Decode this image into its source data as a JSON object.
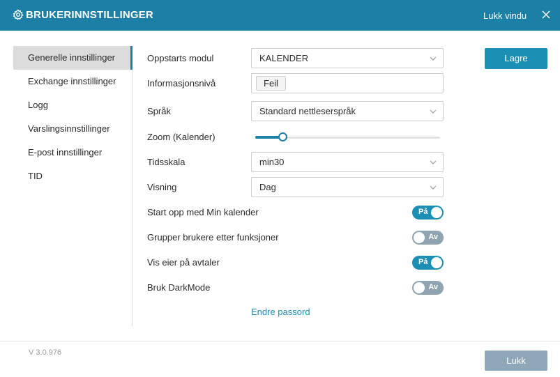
{
  "header": {
    "icon": "gear-icon",
    "title": "BRUKERINNSTILLINGER",
    "close_label": "Lukk vindu",
    "close_icon": "close-icon"
  },
  "sidebar": {
    "items": [
      {
        "label": "Generelle innstillinger",
        "active": true
      },
      {
        "label": "Exchange innstillinger"
      },
      {
        "label": "Logg"
      },
      {
        "label": "Varslingsinnstillinger"
      },
      {
        "label": "E-post innstillinger"
      },
      {
        "label": "TID"
      }
    ]
  },
  "form": {
    "startup_module": {
      "label": "Oppstarts modul",
      "value": "KALENDER"
    },
    "info_level": {
      "label": "Informasjonsnivå",
      "value": "Feil"
    },
    "language": {
      "label": "Språk",
      "value": "Standard nettleserspråk"
    },
    "zoom": {
      "label": "Zoom (Kalender)",
      "level": 0.15
    },
    "timescale": {
      "label": "Tidsskala",
      "value": "min30"
    },
    "view": {
      "label": "Visning",
      "value": "Dag"
    },
    "toggles": [
      {
        "label": "Start opp med Min kalender",
        "state": "on",
        "text": "På"
      },
      {
        "label": "Grupper brukere etter funksjoner",
        "state": "off",
        "text": "Av"
      },
      {
        "label": "Vis eier på avtaler",
        "state": "on",
        "text": "På"
      },
      {
        "label": "Bruk DarkMode",
        "state": "off",
        "text": "Av"
      }
    ],
    "change_password": "Endre passord"
  },
  "actions": {
    "save_label": "Lagre",
    "close_label": "Lukk"
  },
  "footer": {
    "version": "V 3.0.976"
  },
  "colors": {
    "header": "#1c7fa6",
    "accent": "#1c8fb5",
    "toggle_off": "#8fa3b0",
    "close_button": "#8ea8ba"
  }
}
